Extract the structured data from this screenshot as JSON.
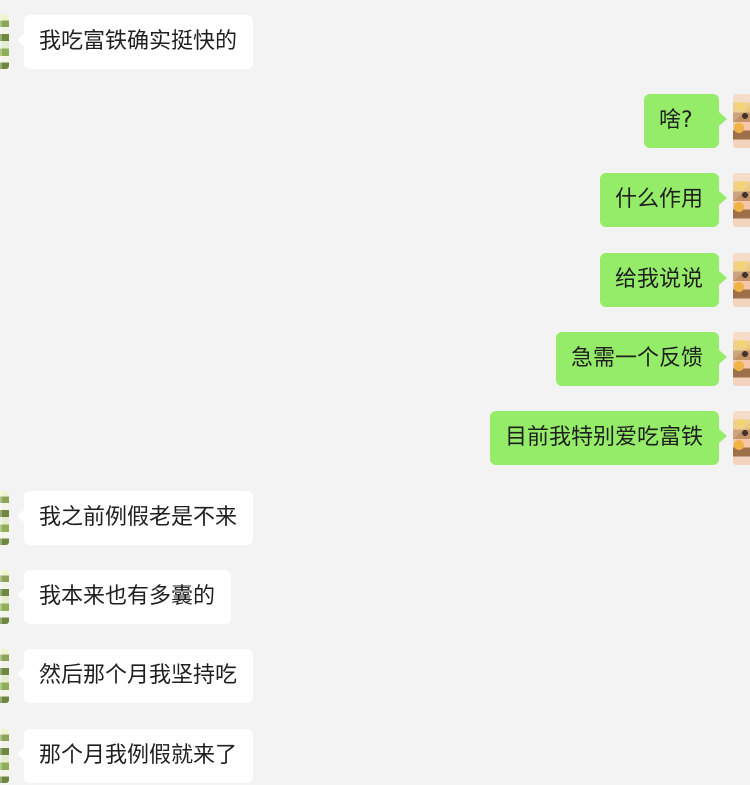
{
  "messages": [
    {
      "side": "left",
      "text": "我吃富铁确实挺快的",
      "avatar_icon": "contact-avatar-icon"
    },
    {
      "side": "right",
      "text": "啥?",
      "avatar_icon": "user-avatar-icon"
    },
    {
      "side": "right",
      "text": "什么作用",
      "avatar_icon": "user-avatar-icon"
    },
    {
      "side": "right",
      "text": "给我说说",
      "avatar_icon": "user-avatar-icon"
    },
    {
      "side": "right",
      "text": "急需一个反馈",
      "avatar_icon": "user-avatar-icon"
    },
    {
      "side": "right",
      "text": "目前我特别爱吃富铁",
      "avatar_icon": "user-avatar-icon"
    },
    {
      "side": "left",
      "text": "我之前例假老是不来",
      "avatar_icon": "contact-avatar-icon"
    },
    {
      "side": "left",
      "text": "我本来也有多囊的",
      "avatar_icon": "contact-avatar-icon"
    },
    {
      "side": "left",
      "text": "然后那个月我坚持吃",
      "avatar_icon": "contact-avatar-icon"
    },
    {
      "side": "left",
      "text": "那个月我例假就来了",
      "avatar_icon": "contact-avatar-icon"
    }
  ],
  "theme": {
    "background": "#f3f3f3",
    "incoming_bubble": "#ffffff",
    "outgoing_bubble": "#95ec69",
    "text": "#1f1f1f"
  }
}
